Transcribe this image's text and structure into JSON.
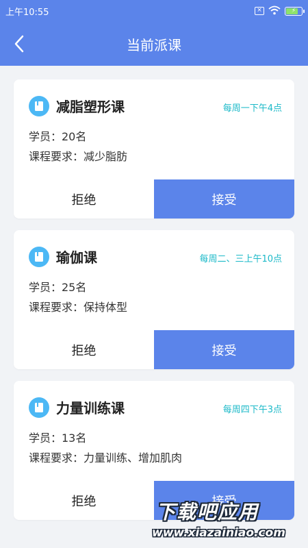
{
  "status_bar": {
    "time": "上午10:55",
    "icons": [
      "sim-no-signal-icon",
      "wifi-icon",
      "battery-charging-icon"
    ]
  },
  "nav": {
    "title": "当前派课",
    "back_icon": "chevron-left-icon"
  },
  "courses": [
    {
      "name": "减脂塑形课",
      "time": "每周一下午4点",
      "students": "学员：20名",
      "requirement": "课程要求：减少脂肪",
      "reject_label": "拒绝",
      "accept_label": "接受"
    },
    {
      "name": "瑜伽课",
      "time": "每周二、三上午10点",
      "students": "学员：25名",
      "requirement": "课程要求：保持体型",
      "reject_label": "拒绝",
      "accept_label": "接受"
    },
    {
      "name": "力量训练课",
      "time": "每周四下午3点",
      "students": "学员：13名",
      "requirement": "课程要求：力量训练、增加肌肉",
      "reject_label": "拒绝",
      "accept_label": "接受"
    }
  ],
  "watermark": {
    "title": "下载吧应用",
    "url": "www.xiazainiao.com"
  },
  "colors": {
    "primary": "#5b84ea",
    "time_text": "#1bb9c8",
    "icon_bg": "#4cb8f5",
    "page_bg": "#f1f3f6"
  }
}
